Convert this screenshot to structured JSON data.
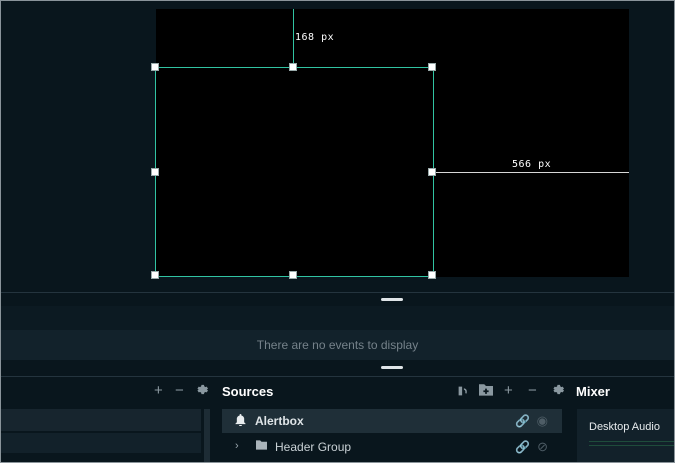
{
  "preview": {
    "top_guide_label": "168 px",
    "right_guide_label": "566 px"
  },
  "events": {
    "empty_text": "There are no events to display"
  },
  "left_dock": {
    "add_icon": "+",
    "remove_icon": "−",
    "settings_icon": "gear-icon"
  },
  "sources": {
    "title": "Sources",
    "items": [
      {
        "label": "Alertbox",
        "icon": "bell-icon"
      },
      {
        "label": "Header Group",
        "icon": "folder-icon"
      }
    ]
  },
  "mixer": {
    "title": "Mixer",
    "channel": "Desktop Audio"
  },
  "colors": {
    "accent": "#31c3a2",
    "background": "#09161d"
  }
}
